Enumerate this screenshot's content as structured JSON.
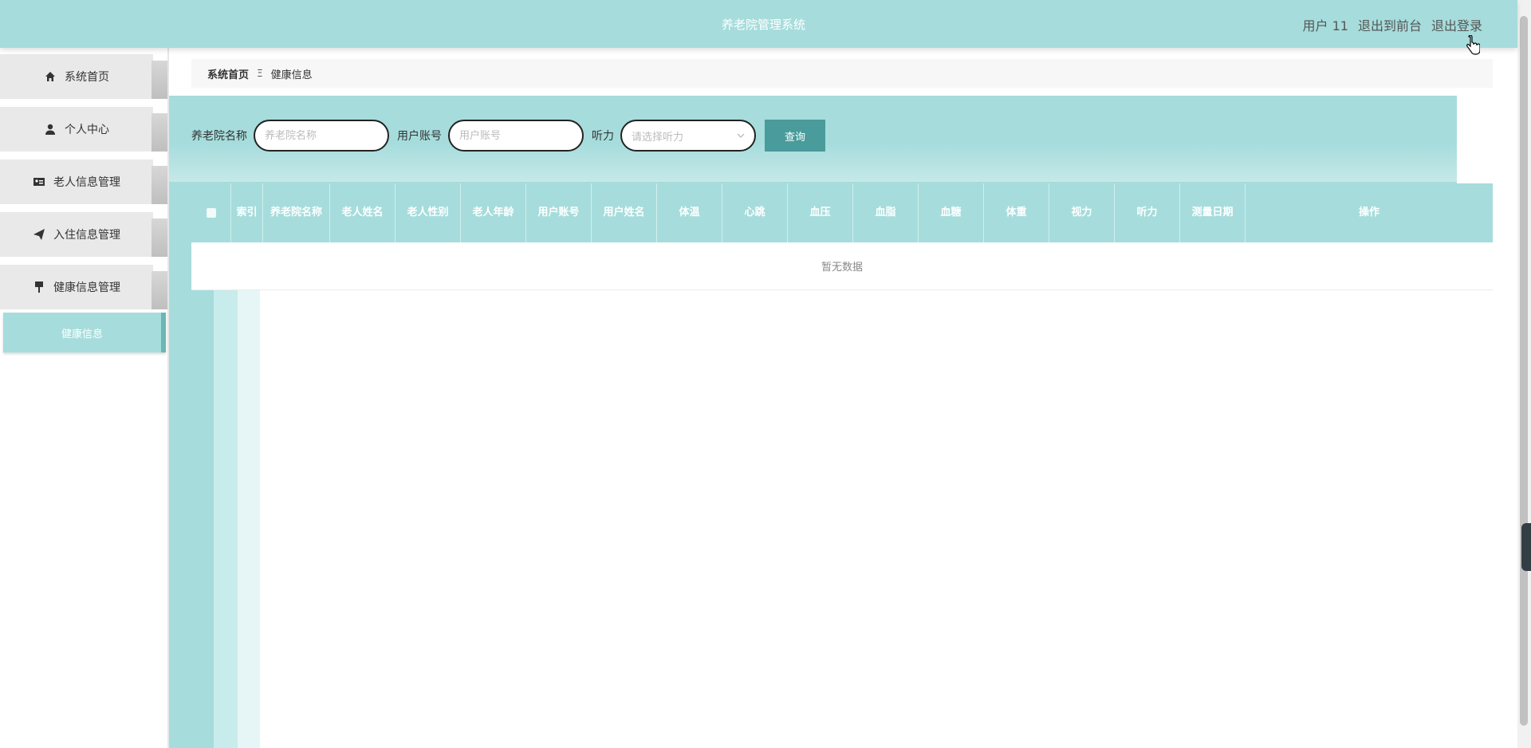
{
  "header": {
    "title": "养老院管理系统",
    "user": "用户 11",
    "front_link": "退出到前台",
    "logout_link": "退出登录"
  },
  "sidebar": {
    "items": [
      {
        "label": "系统首页",
        "icon": "home-icon"
      },
      {
        "label": "个人中心",
        "icon": "user-icon"
      },
      {
        "label": "老人信息管理",
        "icon": "id-card-icon"
      },
      {
        "label": "入住信息管理",
        "icon": "paper-plane-icon"
      },
      {
        "label": "健康信息管理",
        "icon": "brush-icon"
      }
    ],
    "active_sub": "健康信息"
  },
  "breadcrumb": {
    "home": "系统首页",
    "separator": "Ξ",
    "current": "健康信息"
  },
  "search": {
    "name_label": "养老院名称",
    "name_placeholder": "养老院名称",
    "account_label": "用户账号",
    "account_placeholder": "用户账号",
    "hearing_label": "听力",
    "hearing_placeholder": "请选择听力",
    "query_button": "查询"
  },
  "table": {
    "columns": [
      "索引",
      "养老院名称",
      "老人姓名",
      "老人性别",
      "老人年龄",
      "用户账号",
      "用户姓名",
      "体温",
      "心跳",
      "血压",
      "血脂",
      "血糖",
      "体重",
      "视力",
      "听力",
      "测量日期",
      "操作"
    ],
    "empty_text": "暂无数据"
  },
  "colors": {
    "primary": "#a6dcdc",
    "button": "#4a9b9b",
    "active_border": "#6bb6b6"
  }
}
